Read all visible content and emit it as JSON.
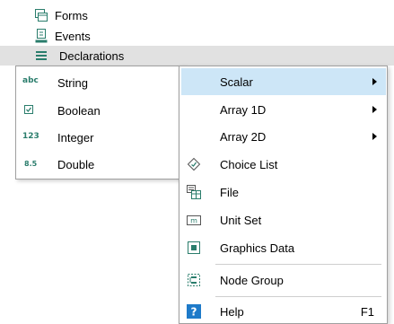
{
  "tree": {
    "forms_label": "Forms",
    "events_label": "Events",
    "declarations_label": "Declarations"
  },
  "scalar_submenu": {
    "items": [
      {
        "icon": "abc",
        "label": "String"
      },
      {
        "icon": "checkbox",
        "label": "Boolean"
      },
      {
        "icon": "123",
        "label": "Integer"
      },
      {
        "icon": "8.5",
        "label": "Double"
      }
    ]
  },
  "context_menu": {
    "scalar": "Scalar",
    "array1d": "Array 1D",
    "array2d": "Array 2D",
    "choice_list": "Choice List",
    "file": "File",
    "unit_set": "Unit Set",
    "graphics_data": "Graphics Data",
    "node_group": "Node Group",
    "help": "Help",
    "help_shortcut": "F1"
  },
  "colors": {
    "hover_bg": "#cde6f7",
    "selected_row_bg": "#e1e1e1",
    "icon_teal": "#2a7d6c",
    "help_blue": "#1e7ac9"
  }
}
